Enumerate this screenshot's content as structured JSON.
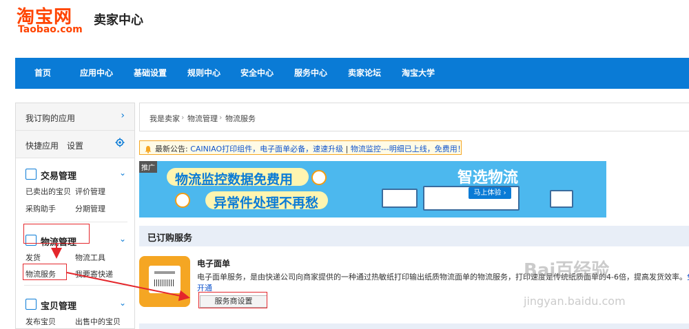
{
  "header": {
    "logo_cn": "淘宝网",
    "logo_en": "Taobao.com",
    "title": "卖家中心"
  },
  "nav": {
    "items": [
      "首页",
      "应用中心",
      "基础设置",
      "规则中心",
      "安全中心",
      "服务中心",
      "卖家论坛",
      "淘宝大学"
    ]
  },
  "sidebar": {
    "subscribed_apps": "我订购的应用",
    "quick_apps": "快捷应用",
    "quick_settings": "设置",
    "groups": [
      {
        "title": "交易管理",
        "items": [
          "已卖出的宝贝",
          "评价管理",
          "采购助手",
          "分期管理"
        ]
      },
      {
        "title": "物流管理",
        "items": [
          "发货",
          "物流工具",
          "物流服务",
          "我要寄快递"
        ]
      },
      {
        "title": "宝贝管理",
        "items": [
          "发布宝贝",
          "出售中的宝贝"
        ]
      }
    ]
  },
  "breadcrumb": [
    "我是卖家",
    "物流管理",
    "物流服务"
  ],
  "notice": {
    "prefix": "最新公告: ",
    "text": "CAINIAO打印组件，电子面单必备，速速升级",
    "sep": " | ",
    "link": "物流监控---明细已上线，免费用！"
  },
  "banner": {
    "tag": "推广",
    "line1": "物流监控数据免费用",
    "line2": "异常件处理不再愁",
    "brand": "智选物流",
    "cta": "马上体验 ›"
  },
  "subscribed_section": {
    "title": "已订购服务"
  },
  "service": {
    "name": "电子面单",
    "description": "电子面单服务，是由快递公司向商家提供的一种通过热敏纸打印输出纸质物流面单的物流服务，打印速度是传统纸质面单的4-6倍，提高发货效率。",
    "more": "免费",
    "open": "开通",
    "button": "服务商设置"
  },
  "watermark": {
    "main": "Bai百经验",
    "sub": "jingyan.baidu.com"
  },
  "colors": {
    "nav_bg": "#0a7bd6",
    "brand": "#ff4400",
    "annotation": "#e4262b",
    "banner_bg": "#4cb8ee"
  }
}
